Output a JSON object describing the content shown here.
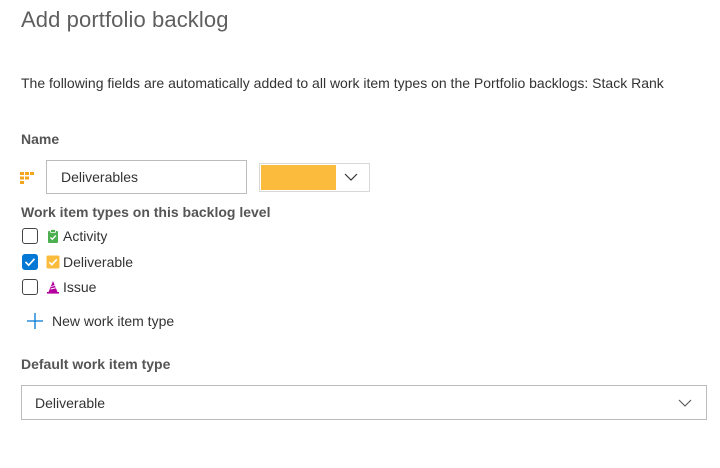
{
  "dialog": {
    "title": "Add portfolio backlog",
    "description": "The following fields are automatically added to all work item types on the Portfolio backlogs: Stack Rank"
  },
  "name_section": {
    "label": "Name",
    "icon": "backlog-icon",
    "value": "Deliverables",
    "color": "#fbbc3d"
  },
  "work_item_types": {
    "label": "Work item types on this backlog level",
    "items": [
      {
        "label": "Activity",
        "checked": false,
        "icon": "activity-icon",
        "icon_color": "#4caf50"
      },
      {
        "label": "Deliverable",
        "checked": true,
        "icon": "deliverable-icon",
        "icon_color": "#fbbc3d"
      },
      {
        "label": "Issue",
        "checked": false,
        "icon": "issue-icon",
        "icon_color": "#b4009e"
      }
    ],
    "new_label": "New work item type"
  },
  "default_type": {
    "label": "Default work item type",
    "value": "Deliverable"
  },
  "colors": {
    "accent": "#0078d4",
    "backlog_icon": "#f2a51d"
  }
}
